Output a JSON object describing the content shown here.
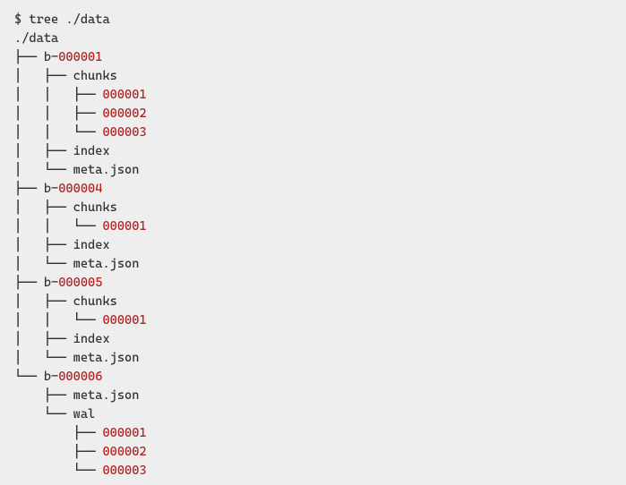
{
  "prompt": "$ ",
  "command": "tree ./data",
  "root": "./data",
  "lines": [
    {
      "tree": "├── ",
      "prefix": "b-",
      "name": "000001",
      "red": true
    },
    {
      "tree": "│   ├── ",
      "prefix": "",
      "name": "chunks",
      "red": false
    },
    {
      "tree": "│   │   ├── ",
      "prefix": "",
      "name": "000001",
      "red": true
    },
    {
      "tree": "│   │   ├── ",
      "prefix": "",
      "name": "000002",
      "red": true
    },
    {
      "tree": "│   │   └── ",
      "prefix": "",
      "name": "000003",
      "red": true
    },
    {
      "tree": "│   ├── ",
      "prefix": "",
      "name": "index",
      "red": false
    },
    {
      "tree": "│   └── ",
      "prefix": "",
      "name": "meta.json",
      "red": false
    },
    {
      "tree": "├── ",
      "prefix": "b-",
      "name": "000004",
      "red": true
    },
    {
      "tree": "│   ├── ",
      "prefix": "",
      "name": "chunks",
      "red": false
    },
    {
      "tree": "│   │   └── ",
      "prefix": "",
      "name": "000001",
      "red": true
    },
    {
      "tree": "│   ├── ",
      "prefix": "",
      "name": "index",
      "red": false
    },
    {
      "tree": "│   └── ",
      "prefix": "",
      "name": "meta.json",
      "red": false
    },
    {
      "tree": "├── ",
      "prefix": "b-",
      "name": "000005",
      "red": true
    },
    {
      "tree": "│   ├── ",
      "prefix": "",
      "name": "chunks",
      "red": false
    },
    {
      "tree": "│   │   └── ",
      "prefix": "",
      "name": "000001",
      "red": true
    },
    {
      "tree": "│   ├── ",
      "prefix": "",
      "name": "index",
      "red": false
    },
    {
      "tree": "│   └── ",
      "prefix": "",
      "name": "meta.json",
      "red": false
    },
    {
      "tree": "└── ",
      "prefix": "b-",
      "name": "000006",
      "red": true
    },
    {
      "tree": "    ├── ",
      "prefix": "",
      "name": "meta.json",
      "red": false
    },
    {
      "tree": "    └── ",
      "prefix": "",
      "name": "wal",
      "red": false
    },
    {
      "tree": "        ├── ",
      "prefix": "",
      "name": "000001",
      "red": true
    },
    {
      "tree": "        ├── ",
      "prefix": "",
      "name": "000002",
      "red": true
    },
    {
      "tree": "        └── ",
      "prefix": "",
      "name": "000003",
      "red": true
    }
  ]
}
